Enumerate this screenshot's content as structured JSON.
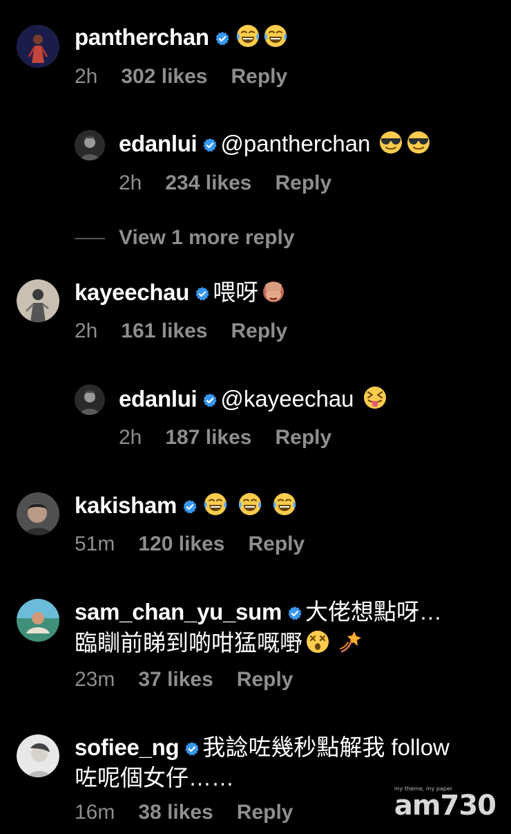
{
  "colors": {
    "background": "#000000",
    "text": "#ffffff",
    "meta": "#8e8e8e",
    "verified": "#3897f0"
  },
  "comments": [
    {
      "username": "pantherchan",
      "text": "",
      "emojis": [
        "face-with-tears-of-joy",
        "face-with-tears-of-joy"
      ],
      "time": "2h",
      "likes": "302 likes",
      "reply": "Reply"
    },
    {
      "username": "edanlui",
      "text": "@pantherchan",
      "emojis": [
        "smiling-face-with-sunglasses",
        "smiling-face-with-sunglasses"
      ],
      "time": "2h",
      "likes": "234 likes",
      "reply": "Reply"
    },
    {
      "username": "kayeechau",
      "text": "喂呀",
      "emojis": [
        "see-no-evil-monkey"
      ],
      "time": "2h",
      "likes": "161 likes",
      "reply": "Reply"
    },
    {
      "username": "edanlui",
      "text": "@kayeechau",
      "emojis": [
        "squinting-face-with-tongue"
      ],
      "time": "2h",
      "likes": "187 likes",
      "reply": "Reply"
    },
    {
      "username": "kakisham",
      "text": "",
      "emojis": [
        "face-with-tears-of-joy",
        "face-with-tears-of-joy",
        "face-with-tears-of-joy"
      ],
      "time": "51m",
      "likes": "120 likes",
      "reply": "Reply"
    },
    {
      "username": "sam_chan_yu_sum",
      "text": "大佬想點呀…",
      "text2": "臨瞓前睇到啲咁猛嘅嘢",
      "emojis": [
        "dizzy-face",
        "dizzy-symbol"
      ],
      "time": "23m",
      "likes": "37 likes",
      "reply": "Reply"
    },
    {
      "username": "sofiee_ng",
      "text": "我諗咗幾秒點解我 follow",
      "text2": "咗呢個女仔……",
      "time": "16m",
      "likes": "38 likes",
      "reply": "Reply"
    }
  ],
  "view_more": "View 1 more reply",
  "watermark": {
    "main": "am730",
    "small": "my theme, my paper"
  }
}
